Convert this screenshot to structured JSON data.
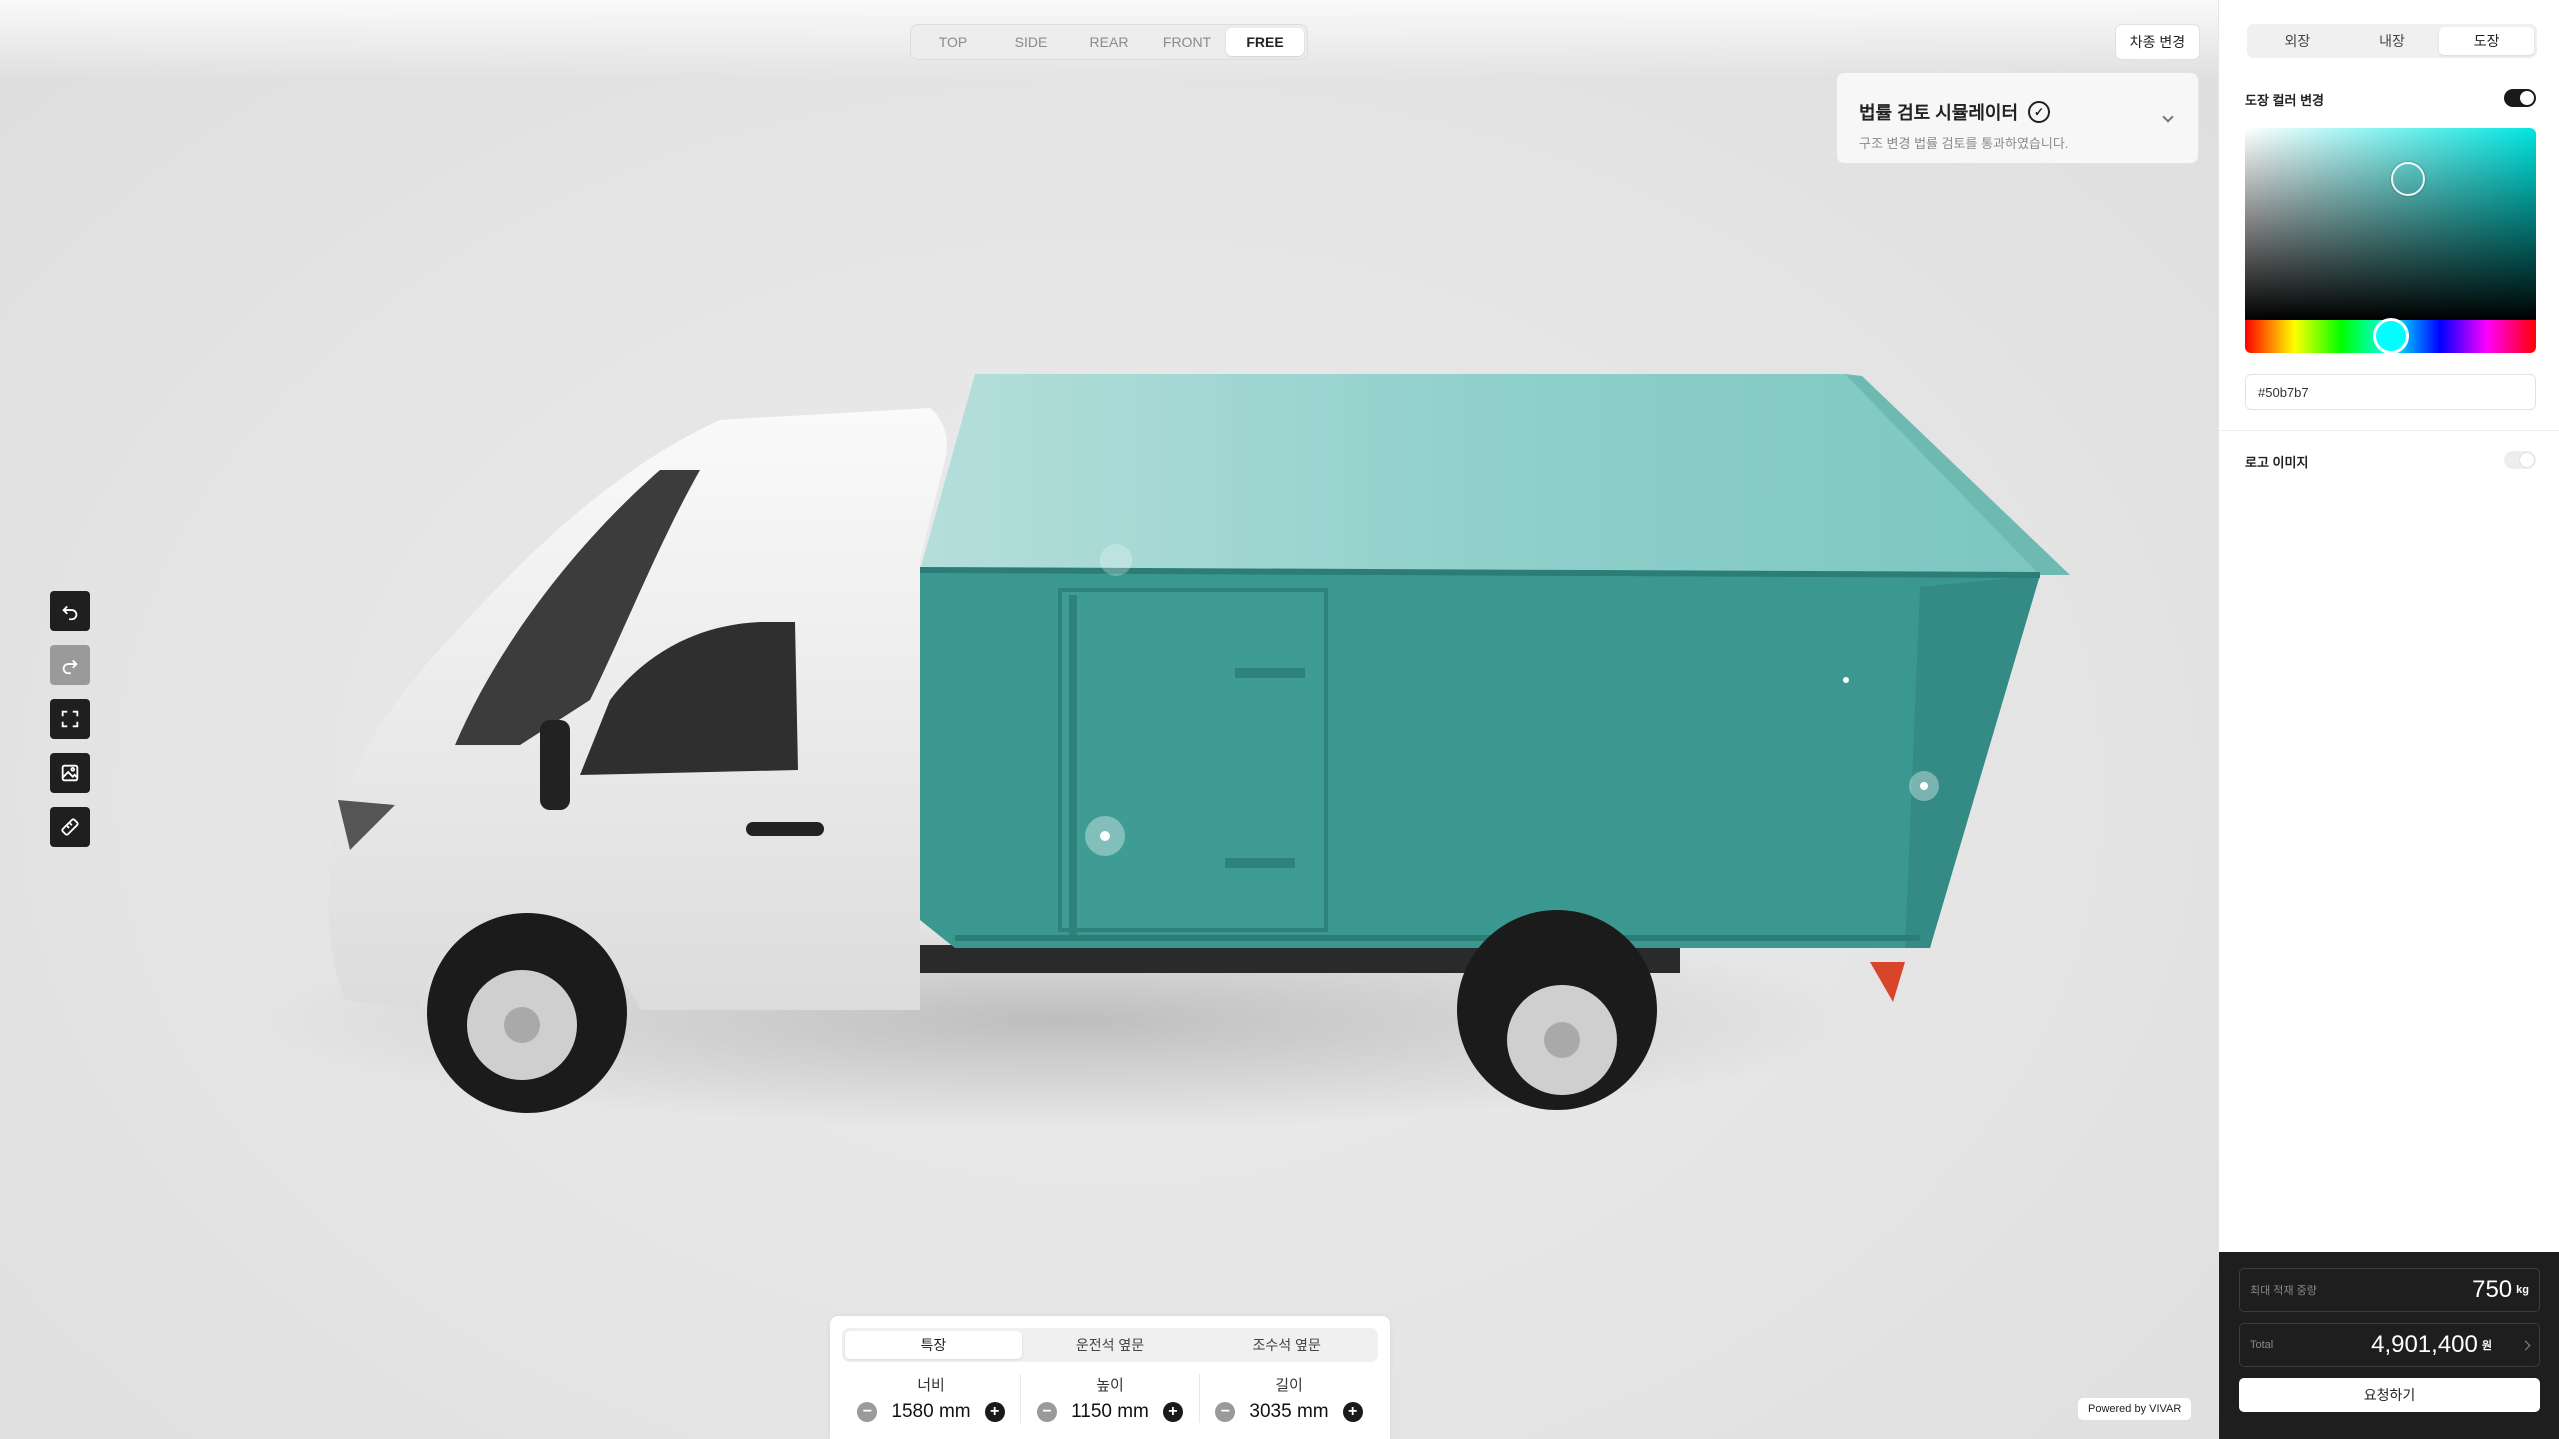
{
  "camera_tabs": [
    "TOP",
    "SIDE",
    "REAR",
    "FRONT",
    "FREE"
  ],
  "camera_active": "FREE",
  "vehicle_change_label": "차종 변경",
  "legal": {
    "title": "법률 검토 시뮬레이터",
    "subtitle": "구조 변경 법률 검토를 통과하였습니다."
  },
  "toolbar_icons": [
    "undo-icon",
    "redo-icon",
    "fullscreen-icon",
    "image-icon",
    "ruler-icon"
  ],
  "dimensions": {
    "tabs": [
      "특장",
      "운전석 옆문",
      "조수석 옆문"
    ],
    "active_tab": "특장",
    "items": [
      {
        "label": "너비",
        "value": "1580",
        "unit": "mm"
      },
      {
        "label": "높이",
        "value": "1150",
        "unit": "mm"
      },
      {
        "label": "길이",
        "value": "3035",
        "unit": "mm"
      }
    ]
  },
  "powered_by": "Powered by VIVAR",
  "panel": {
    "tabs": [
      "외장",
      "내장",
      "도장"
    ],
    "active_tab": "도장",
    "paint_color_label": "도장 컬러 변경",
    "paint_color_enabled": true,
    "hex_value": "#50b7b7",
    "logo_label": "로고 이미지",
    "logo_enabled": false
  },
  "summary": {
    "max_load_label": "최대 적재 중량",
    "max_load_value": "750",
    "max_load_unit": "kg",
    "total_label": "Total",
    "total_value": "4,901,400",
    "total_unit": "원",
    "request_label": "요청하기"
  },
  "colors": {
    "box_body": "#3b9891",
    "box_top": "#8fd0cb",
    "cab": "#f1f1f1",
    "accent_dark": "#1e1e1e"
  }
}
